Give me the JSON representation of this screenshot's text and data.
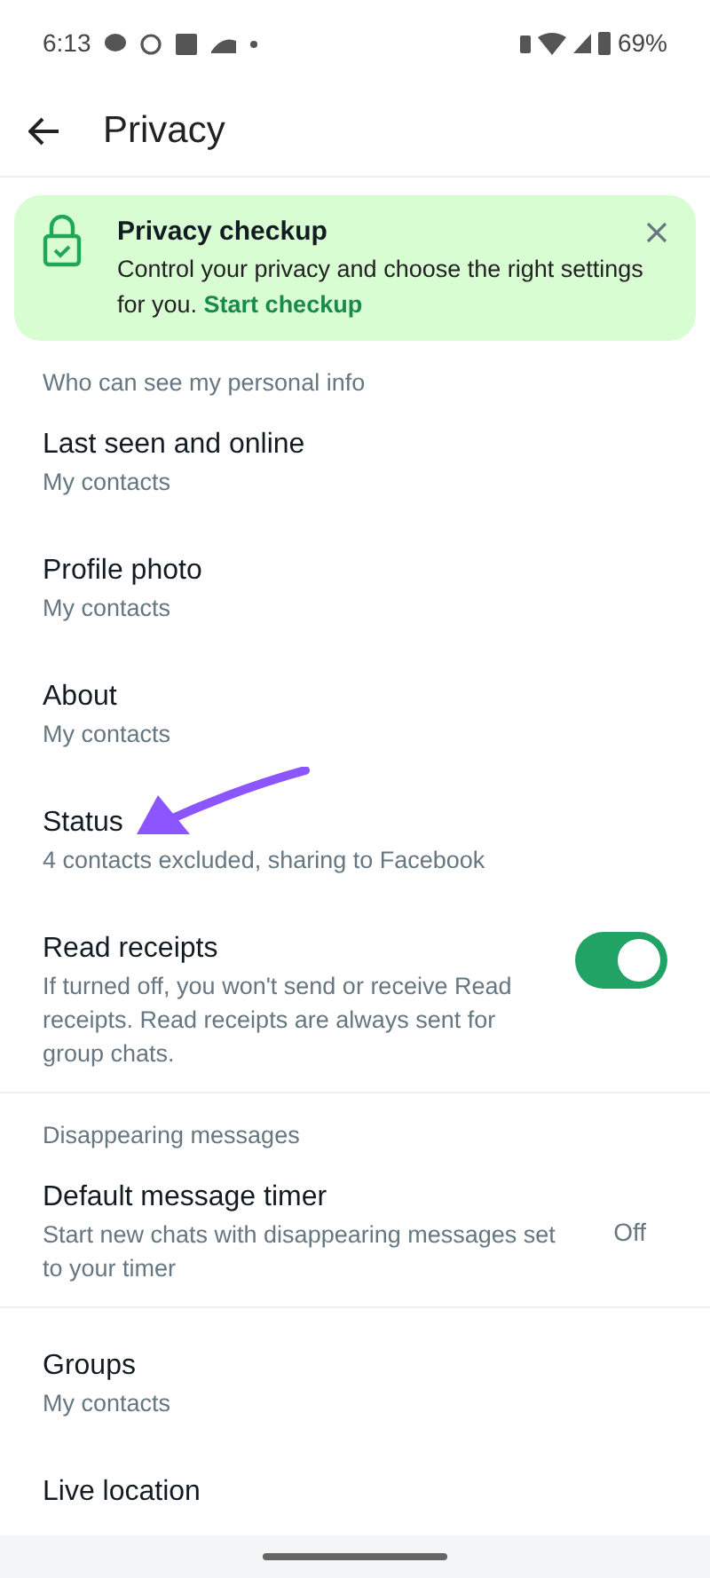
{
  "status_bar": {
    "time": "6:13",
    "battery": "69%"
  },
  "header": {
    "title": "Privacy"
  },
  "checkup_card": {
    "title": "Privacy checkup",
    "text": "Control your privacy and choose the right settings for you.",
    "link": "Start checkup"
  },
  "sections": [
    {
      "title": "Who can see my personal info",
      "items": [
        {
          "kind": "nav",
          "title": "Last seen and online",
          "subtitle": "My contacts"
        },
        {
          "kind": "nav",
          "title": "Profile photo",
          "subtitle": "My contacts"
        },
        {
          "kind": "nav",
          "title": "About",
          "subtitle": "My contacts"
        },
        {
          "kind": "nav",
          "title": "Status",
          "subtitle": "4 contacts excluded, sharing to Facebook"
        },
        {
          "kind": "toggle",
          "title": "Read receipts",
          "subtitle": "If turned off, you won't send or receive Read receipts. Read receipts are always sent for group chats.",
          "on": true
        }
      ]
    },
    {
      "title": "Disappearing messages",
      "items": [
        {
          "kind": "value",
          "title": "Default message timer",
          "subtitle": "Start new chats with disappearing messages set to your timer",
          "value": "Off"
        }
      ]
    },
    {
      "items": [
        {
          "kind": "nav",
          "title": "Groups",
          "subtitle": "My contacts"
        },
        {
          "kind": "nav",
          "title": "Live location"
        }
      ]
    }
  ]
}
